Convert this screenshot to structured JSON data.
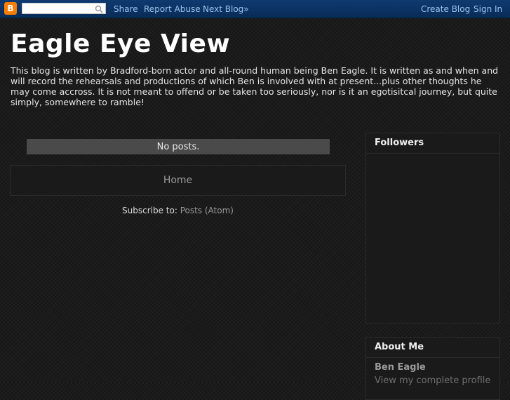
{
  "navbar": {
    "logo_glyph": "B",
    "search_placeholder": "",
    "links": {
      "share": "Share",
      "report_abuse": "Report Abuse",
      "next_blog": "Next Blog»",
      "create_blog": "Create Blog",
      "sign_in": "Sign In"
    }
  },
  "header": {
    "title": "Eagle Eye View",
    "description": "This blog is written by Bradford-born actor and all-round human being Ben Eagle. It is written as and when and will record the rehearsals and productions of which Ben is involved with at present...plus other thoughts he may come accross. It is not meant to offend or be taken too seriously, nor is it an egotisitcal journey, but quite simply, somewhere to ramble!"
  },
  "main": {
    "no_posts": "No posts.",
    "home_link": "Home",
    "subscribe_label": "Subscribe to:",
    "subscribe_link": "Posts (Atom)"
  },
  "sidebar": {
    "followers_title": "Followers",
    "about_title": "About Me",
    "profile_name": "Ben Eagle",
    "profile_link": "View my complete profile"
  },
  "colors": {
    "navbar_bg": "#0b3466",
    "nav_link": "#9cc3ee",
    "logo_orange": "#f57d00",
    "page_bg": "#1b1b1b",
    "no_posts_bg": "#4a4a4a"
  }
}
